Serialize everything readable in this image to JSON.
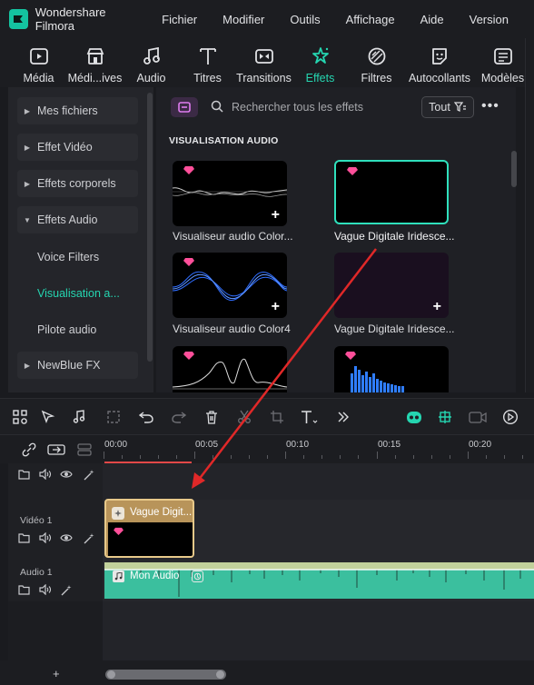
{
  "app": {
    "name": "Wondershare Filmora"
  },
  "menu": [
    "Fichier",
    "Modifier",
    "Outils",
    "Affichage",
    "Aide",
    "Version"
  ],
  "tabs": [
    {
      "label": "Média",
      "icon": "media-icon"
    },
    {
      "label": "Médi...ives",
      "icon": "stock-media-icon"
    },
    {
      "label": "Audio",
      "icon": "music-note-icon"
    },
    {
      "label": "Titres",
      "icon": "title-t-icon"
    },
    {
      "label": "Transitions",
      "icon": "transition-icon"
    },
    {
      "label": "Effets",
      "icon": "effects-sparkle-icon"
    },
    {
      "label": "Filtres",
      "icon": "filter-icon"
    },
    {
      "label": "Autocollants",
      "icon": "sticker-icon"
    },
    {
      "label": "Modèles",
      "icon": "template-icon"
    }
  ],
  "active_tab": "Effets",
  "sidebar": {
    "items": [
      {
        "label": "Mes fichiers"
      },
      {
        "label": "Effet Vidéo"
      },
      {
        "label": "Effets corporels"
      },
      {
        "label": "Effets Audio"
      },
      {
        "label": "Voice Filters"
      },
      {
        "label": "Visualisation a..."
      },
      {
        "label": "Pilote audio"
      },
      {
        "label": "NewBlue FX"
      }
    ]
  },
  "panel": {
    "search_placeholder": "Rechercher tous les effets",
    "filter_label": "Tout",
    "section_title": "VISUALISATION AUDIO",
    "cards": [
      {
        "label": "Visualiseur audio Color...",
        "premium": true,
        "selected": false
      },
      {
        "label": "Vague Digitale Iridesce...",
        "premium": true,
        "selected": true
      },
      {
        "label": "Visualiseur audio Color4",
        "premium": true,
        "selected": false
      },
      {
        "label": "Vague Digitale Iridesce...",
        "premium": true,
        "selected": false
      },
      {
        "label": "",
        "premium": true,
        "selected": false
      },
      {
        "label": "",
        "premium": true,
        "selected": false
      }
    ]
  },
  "timeline": {
    "ruler": [
      "00:00",
      "00:05",
      "00:10",
      "00:15",
      "00:20"
    ],
    "tracks": [
      {
        "name": ""
      },
      {
        "name": "Vidéo 1"
      },
      {
        "name": "Audio 1"
      }
    ],
    "video_clip": {
      "title": "Vague Digit..."
    },
    "audio_clip": {
      "title": "Mon Audio"
    }
  },
  "colors": {
    "accent": "#25d5b0",
    "clip_video": "#b8945a",
    "clip_audio": "#3bbf9e",
    "arrow": "#e02828"
  }
}
